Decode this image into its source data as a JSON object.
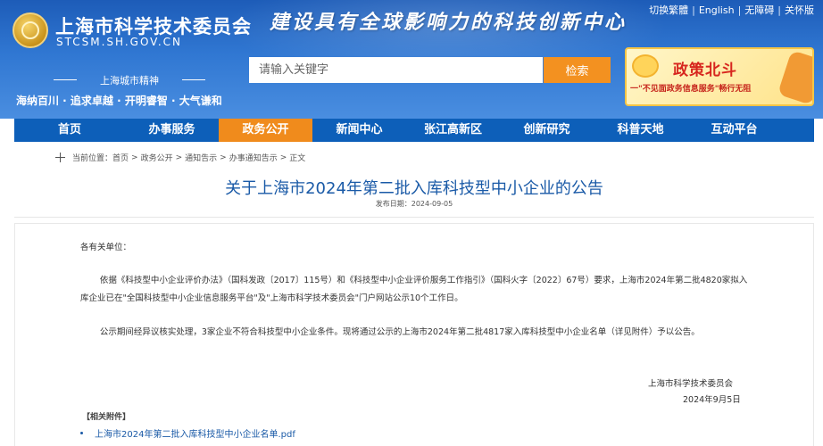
{
  "header": {
    "org_name": "上海市科学技术委员会",
    "domain": "STCSM.SH.GOV.CN",
    "slogan": "建设具有全球影响力的科技创新中心",
    "top_links": [
      "切换繁體",
      "English",
      "无障碍",
      "关怀版"
    ],
    "spirit_title": "上海城市精神",
    "spirit_text": "海纳百川 · 追求卓越 · 开明睿智 · 大气谦和",
    "search": {
      "placeholder": "请输入关键字",
      "button": "检索"
    },
    "policy_banner": {
      "title": "政策北斗",
      "subtitle": "一\"不见面政务信息服务\"畅行无阻"
    }
  },
  "nav": {
    "items": [
      "首页",
      "办事服务",
      "政务公开",
      "新闻中心",
      "张江高新区",
      "创新研究",
      "科普天地",
      "互动平台"
    ],
    "active": "政务公开"
  },
  "breadcrumb": {
    "label": "当前位置：",
    "items": [
      "首页",
      "政务公开",
      "通知告示",
      "办事通知告示",
      "正文"
    ]
  },
  "article": {
    "title": "关于上海市2024年第二批入库科技型中小企业的公告",
    "date": "发布日期：2024-09-05",
    "salutation": "各有关单位：",
    "para1": "依据《科技型中小企业评价办法》（国科发政〔2017〕115号）和《科技型中小企业评价服务工作指引》（国科火字〔2022〕67号）要求，上海市2024年第二批4820家拟入库企业已在\"全国科技型中小企业信息服务平台\"及\"上海市科学技术委员会\"门户网站公示10个工作日。",
    "para2": "公示期间经异议核实处理，3家企业不符合科技型中小企业条件。现将通过公示的上海市2024年第二批4817家入库科技型中小企业名单（详见附件）予以公告。",
    "sign_org": "上海市科学技术委员会",
    "sign_date": "2024年9月5日",
    "attachments_head": "【相关附件】",
    "attachments": [
      "上海市2024年第二批入库科技型中小企业名单.pdf"
    ]
  },
  "colors": {
    "header_blue": "#3077d2",
    "nav_blue": "#0d5fb9",
    "nav_active": "#f08b1c",
    "search_button": "#f39120",
    "title_blue": "#1a5aa7"
  }
}
